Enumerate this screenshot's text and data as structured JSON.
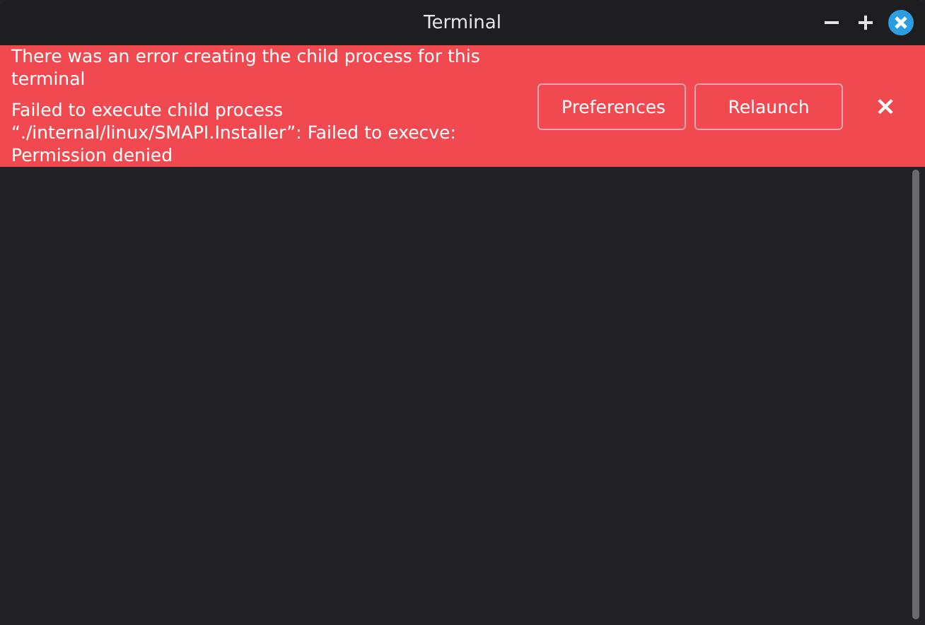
{
  "window": {
    "title": "Terminal"
  },
  "error_bar": {
    "heading": "There was an error creating the child process for this terminal",
    "detail": "Failed to execute child process “./internal/linux/SMAPI.Installer”: Failed to execve: Permission denied",
    "buttons": [
      "Preferences",
      "Relaunch"
    ],
    "dismiss": "×"
  }
}
